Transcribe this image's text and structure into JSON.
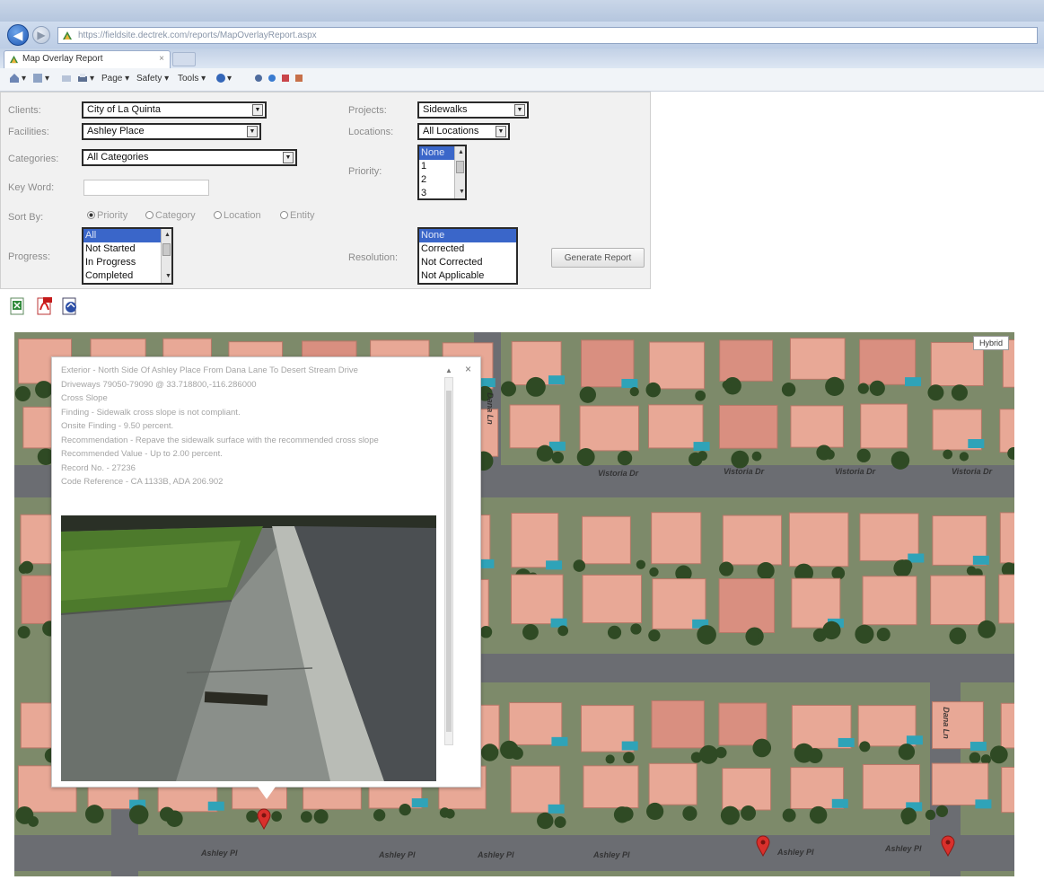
{
  "browser": {
    "address": "https://fieldsite.dectrek.com/reports/MapOverlayReport.aspx",
    "tab_title": "Map Overlay Report",
    "tab_close": "×",
    "toolbar": {
      "page": "Page ▾",
      "safety": "Safety ▾",
      "tools": "Tools ▾",
      "help": "▾"
    }
  },
  "form": {
    "clients_label": "Clients:",
    "clients_value": "City of La Quinta",
    "facilities_label": "Facilities:",
    "facilities_value": "Ashley Place",
    "categories_label": "Categories:",
    "categories_value": "All Categories",
    "keyword_label": "Key Word:",
    "keyword_value": "",
    "sortby_label": "Sort By:",
    "sort_options": [
      "Priority",
      "Category",
      "Location",
      "Entity"
    ],
    "sort_selected": "Priority",
    "progress_label": "Progress:",
    "progress_options": [
      "All",
      "Not Started",
      "In Progress",
      "Completed"
    ],
    "progress_selected": "All",
    "projects_label": "Projects:",
    "projects_value": "Sidewalks",
    "locations_label": "Locations:",
    "locations_value": "All Locations",
    "priority_label": "Priority:",
    "priority_options": [
      "None",
      "1",
      "2",
      "3"
    ],
    "priority_selected": "None",
    "resolution_label": "Resolution:",
    "resolution_options": [
      "None",
      "Corrected",
      "Not Corrected",
      "Not Applicable"
    ],
    "resolution_selected": "None",
    "generate_label": "Generate Report"
  },
  "map": {
    "type_button": "Hybrid",
    "streets": [
      "Vistoria Dr",
      "Vistoria Dr",
      "Vistoria Dr",
      "Vistoria Dr",
      "Ashley Pl",
      "Ashley Pl",
      "Ashley Pl",
      "Ashley Pl",
      "Ashley Pl",
      "Ashley Pl",
      "Dana Ln",
      "Dana Ln"
    ],
    "popup": {
      "lines": [
        "Exterior - North Side Of Ashley Place From Dana Lane To Desert Stream Drive",
        "Driveways 79050-79090 @ 33.718800,-116.286000",
        "Cross Slope",
        "Finding - Sidewalk cross slope is not compliant.",
        "Onsite Finding - 9.50 percent.",
        "Recommendation - Repave the sidewalk surface with the recommended cross slope",
        "Recommended Value - Up to 2.00 percent.",
        "Record No. - 27236",
        "Code Reference - CA 1133B, ADA 206.902"
      ],
      "close": "×"
    }
  },
  "colors": {
    "selected": "#3a66c9",
    "pin": "#d9302c",
    "roof": "#e8a896",
    "road": "#6b6d72"
  }
}
